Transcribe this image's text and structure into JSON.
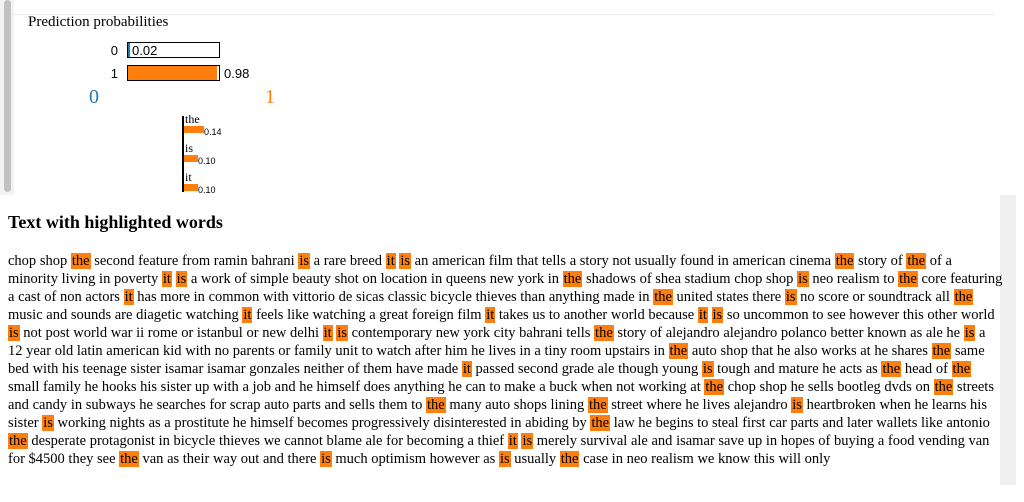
{
  "prediction": {
    "title": "Prediction probabilities",
    "rows": [
      {
        "label": "0",
        "prob": 0.02,
        "value_text": "0.02"
      },
      {
        "label": "1",
        "prob": 0.98,
        "value_text": "0.98"
      }
    ],
    "class_names": [
      "0",
      "1"
    ]
  },
  "features": [
    {
      "word": "the",
      "weight": 0.14,
      "value_text": "0.14"
    },
    {
      "word": "is",
      "weight": 0.1,
      "value_text": "0.10"
    },
    {
      "word": "it",
      "weight": 0.1,
      "value_text": "0.10"
    }
  ],
  "colors": {
    "positive": "#ff7f0e",
    "negative": "#1f77b4"
  },
  "text_section": {
    "title": "Text with highlighted words",
    "highlight_words": [
      "the",
      "is",
      "it"
    ],
    "body": "chop shop the second feature from ramin bahrani is a rare breed it is an american film that tells a story not usually found in american cinema the story of the of a minority living in poverty it is a work of simple beauty shot on location in queens new york in the shadows of shea stadium chop shop is neo realism to the core featuring a cast of non actors it has more in common with vittorio de sicas classic bicycle thieves than anything made in the united states there is no score or soundtrack all the music and sounds are diagetic watching it feels like watching a great foreign film it takes us to another world because it is so uncommon to see however this other world is not post world war ii rome or istanbul or new delhi it is contemporary new york city bahrani tells the story of alejandro alejandro polanco better known as ale he is a 12 year old latin american kid with no parents or family unit to watch after him he lives in a tiny room upstairs in the auto shop that he also works at he shares the same bed with his teenage sister isamar isamar gonzales neither of them have made it passed second grade ale though young is tough and mature he acts as the head of the small family he hooks his sister up with a job and he himself does anything he can to make a buck when not working at the chop shop he sells bootleg dvds on the streets and candy in subways he searches for scrap auto parts and sells them to the many auto shops lining the street where he lives alejandro is heartbroken when he learns his sister is working nights as a prostitute he himself becomes progressively disinterested in abiding by the law he begins to steal first car parts and later wallets like antonio the desperate protagonist in bicycle thieves we cannot blame ale for becoming a thief it is merely survival ale and isamar save up in hopes of buying a food vending van for $4500 they see the van as their way out and there is much optimism however as is usually the case in neo realism we know this will only"
  }
}
